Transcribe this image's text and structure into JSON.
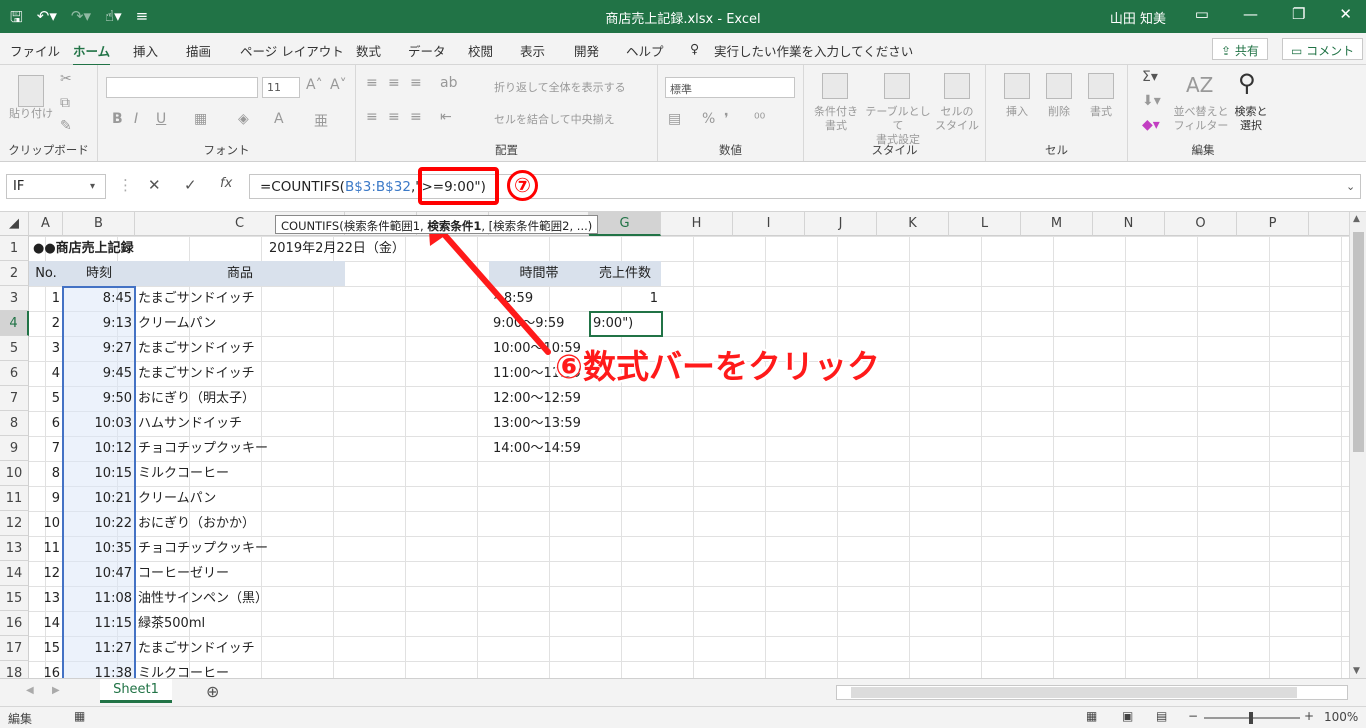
{
  "window": {
    "title": "商店売上記録.xlsx  -  Excel",
    "user": "山田 知美"
  },
  "tabs": [
    "ファイル",
    "ホーム",
    "挿入",
    "描画",
    "ページ レイアウト",
    "数式",
    "データ",
    "校閲",
    "表示",
    "開発",
    "ヘルプ"
  ],
  "tell_me": "実行したい作業を入力してください",
  "share_label": "共有",
  "comment_label": "コメント",
  "ribbon": {
    "clipboard": {
      "label": "クリップボード",
      "paste": "貼り付け"
    },
    "font": {
      "label": "フォント",
      "size": "11",
      "bold": "B",
      "italic": "I",
      "underline": "U"
    },
    "alignment": {
      "label": "配置",
      "wrap": "折り返して全体を表示する",
      "merge": "セルを結合して中央揃え"
    },
    "number": {
      "label": "数値",
      "format": "標準"
    },
    "style": {
      "label": "スタイル",
      "cond1": "条件付き",
      "cond2": "書式",
      "table1": "テーブルとして",
      "table2": "書式設定",
      "cell1": "セルの",
      "cell2": "スタイル"
    },
    "cells": {
      "label": "セル",
      "insert": "挿入",
      "delete": "削除",
      "format": "書式"
    },
    "editing": {
      "label": "編集",
      "sort1": "並べ替えと",
      "sort2": "フィルター",
      "find1": "検索と",
      "find2": "選択"
    }
  },
  "formula_bar": {
    "name_box": "IF",
    "prefix": "=COUNTIFS(",
    "range": "B$3:B$32",
    "criteria": ",\">=9:00\")"
  },
  "tooltip": {
    "fn": "COUNTIFS(検索条件範囲1, ",
    "bold": "検索条件1",
    "rest": ", [検索条件範囲2, ...)"
  },
  "columns": [
    "A",
    "B",
    "C",
    "D",
    "E",
    "F",
    "G",
    "H",
    "I",
    "J",
    "K",
    "L",
    "M",
    "N",
    "O",
    "P"
  ],
  "rows": [
    "1",
    "2",
    "3",
    "4",
    "5",
    "6",
    "7",
    "8",
    "9",
    "10",
    "11",
    "12",
    "13",
    "14",
    "15",
    "16",
    "17",
    "18"
  ],
  "sheet": {
    "title": "●●商店売上記録",
    "date": "2019年2月22日（金）",
    "headers": {
      "no": "No.",
      "time": "時刻",
      "product": "商品",
      "slot": "時間帯",
      "count": "売上件数"
    },
    "records": [
      {
        "no": "1",
        "time": "8:45",
        "product": "たまごサンドイッチ"
      },
      {
        "no": "2",
        "time": "9:13",
        "product": "クリームパン"
      },
      {
        "no": "3",
        "time": "9:27",
        "product": "たまごサンドイッチ"
      },
      {
        "no": "4",
        "time": "9:45",
        "product": "たまごサンドイッチ"
      },
      {
        "no": "5",
        "time": "9:50",
        "product": "おにぎり（明太子）"
      },
      {
        "no": "6",
        "time": "10:03",
        "product": "ハムサンドイッチ"
      },
      {
        "no": "7",
        "time": "10:12",
        "product": "チョコチップクッキー"
      },
      {
        "no": "8",
        "time": "10:15",
        "product": "ミルクコーヒー"
      },
      {
        "no": "9",
        "time": "10:21",
        "product": "クリームパン"
      },
      {
        "no": "10",
        "time": "10:22",
        "product": "おにぎり（おかか）"
      },
      {
        "no": "11",
        "time": "10:35",
        "product": "チョコチップクッキー"
      },
      {
        "no": "12",
        "time": "10:47",
        "product": "コーヒーゼリー"
      },
      {
        "no": "13",
        "time": "11:08",
        "product": "油性サインペン（黒）"
      },
      {
        "no": "14",
        "time": "11:15",
        "product": "緑茶500ml"
      },
      {
        "no": "15",
        "time": "11:27",
        "product": "たまごサンドイッチ"
      },
      {
        "no": "16",
        "time": "11:38",
        "product": "ミルクコーヒー"
      }
    ],
    "slots": [
      "~8:59",
      "9:00～9:59",
      "10:00～10:59",
      "11:00～11:59",
      "12:00～12:59",
      "13:00～13:59",
      "14:00～14:59"
    ],
    "count_g3": "1",
    "active_cell_text": "9:00\")"
  },
  "annotations": {
    "step7": "⑦",
    "step6": "⑥数式バーをクリック"
  },
  "sheet_tab": "Sheet1",
  "status": {
    "mode": "編集",
    "zoom": "100%"
  }
}
